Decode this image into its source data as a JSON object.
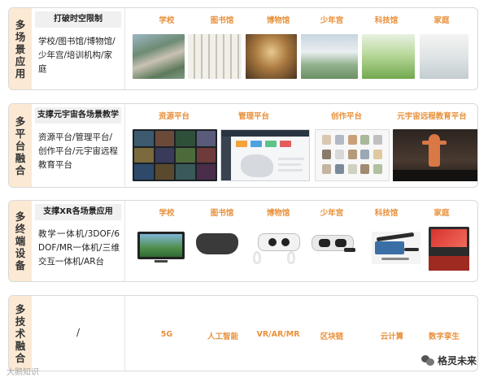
{
  "rows": [
    {
      "side_title": "多场景应用",
      "header": "打破时空限制",
      "description": "学校/图书馆/博物馆/少年宫/培训机构/家庭",
      "labels": [
        "学校",
        "图书馆",
        "博物馆",
        "少年宫",
        "科技馆",
        "家庭"
      ]
    },
    {
      "side_title": "多平台融合",
      "header": "支撑元宇宙各场景教学",
      "description": "资源平台/管理平台/创作平台/元宇宙远程教育平台",
      "labels": [
        "资源平台",
        "管理平台",
        "创作平台",
        "元宇宙远程教育平台"
      ]
    },
    {
      "side_title": "多终端设备",
      "header": "支撑XR各场景应用",
      "description": "教学一体机/3DOF/6DOF/MR一体机/三维交互一体机/AR台",
      "labels": [
        "学校",
        "图书馆",
        "博物馆",
        "少年宫",
        "科技馆",
        "家庭"
      ]
    },
    {
      "side_title": "多技术融合",
      "description": "/",
      "labels": [
        "5G",
        "人工智能",
        "VR/AR/MR",
        "区块链",
        "云计算",
        "数字孪生"
      ]
    }
  ],
  "watermark_left": "大鹅知识",
  "watermark_right": "格灵未来",
  "colors": {
    "accent": "#e8913c",
    "side_bg": "#fbe9d4",
    "header_bg": "#f0f0f0"
  }
}
